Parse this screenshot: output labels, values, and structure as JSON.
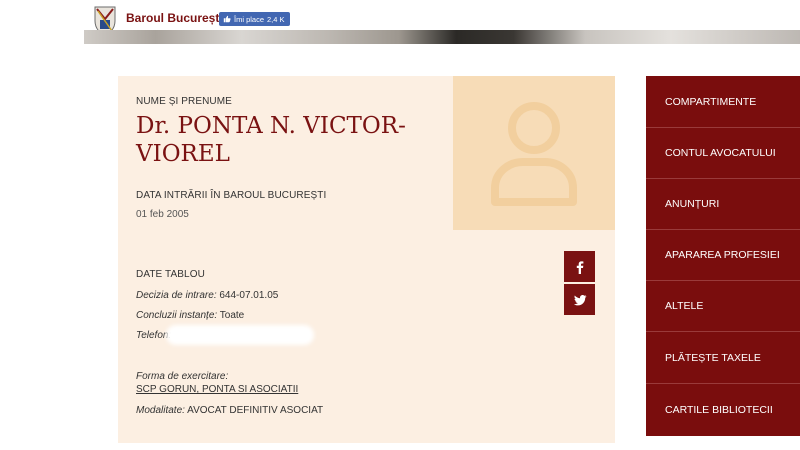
{
  "header": {
    "brand": "Baroul București",
    "like_label": "Îmi place",
    "like_count": "2,4 K"
  },
  "profile": {
    "name_label": "NUME ȘI PRENUME",
    "name_line1": "Dr. PONTA N. VICTOR-",
    "name_line2": "VIOREL",
    "entry_label": "DATA INTRĂRII ÎN BAROUL BUCUREȘTI",
    "entry_date": "01 feb 2005",
    "tablou_label": "DATE TABLOU",
    "decizie_label": "Decizia de intrare:",
    "decizie_value": "644-07.01.05",
    "concluzii_label": "Concluzii instanțe:",
    "concluzii_value": "Toate",
    "telefon_label": "Telefon:",
    "forma_label": "Forma de exercitare:",
    "forma_value": "SCP GORUN, PONTA SI ASOCIATII",
    "modalitate_label": "Modalitate:",
    "modalitate_value": "AVOCAT DEFINITIV ASOCIAT"
  },
  "social": {
    "facebook_icon": "facebook-icon",
    "twitter_icon": "twitter-icon"
  },
  "sidebar": {
    "items": [
      {
        "label": "COMPARTIMENTE"
      },
      {
        "label": "CONTUL AVOCATULUI"
      },
      {
        "label": "ANUNȚURI"
      },
      {
        "label": "APARAREA PROFESIEI"
      },
      {
        "label": "ALTELE"
      },
      {
        "label": "PLĂTEȘTE TAXELE"
      },
      {
        "label": "CARTILE BIBLIOTECII"
      }
    ]
  },
  "colors": {
    "brand": "#7a1212",
    "card_bg": "#fcefe2",
    "photo_bg": "#f7dcb7",
    "sidebar_bg": "#7a0d0d",
    "like_blue": "#4267b2"
  }
}
